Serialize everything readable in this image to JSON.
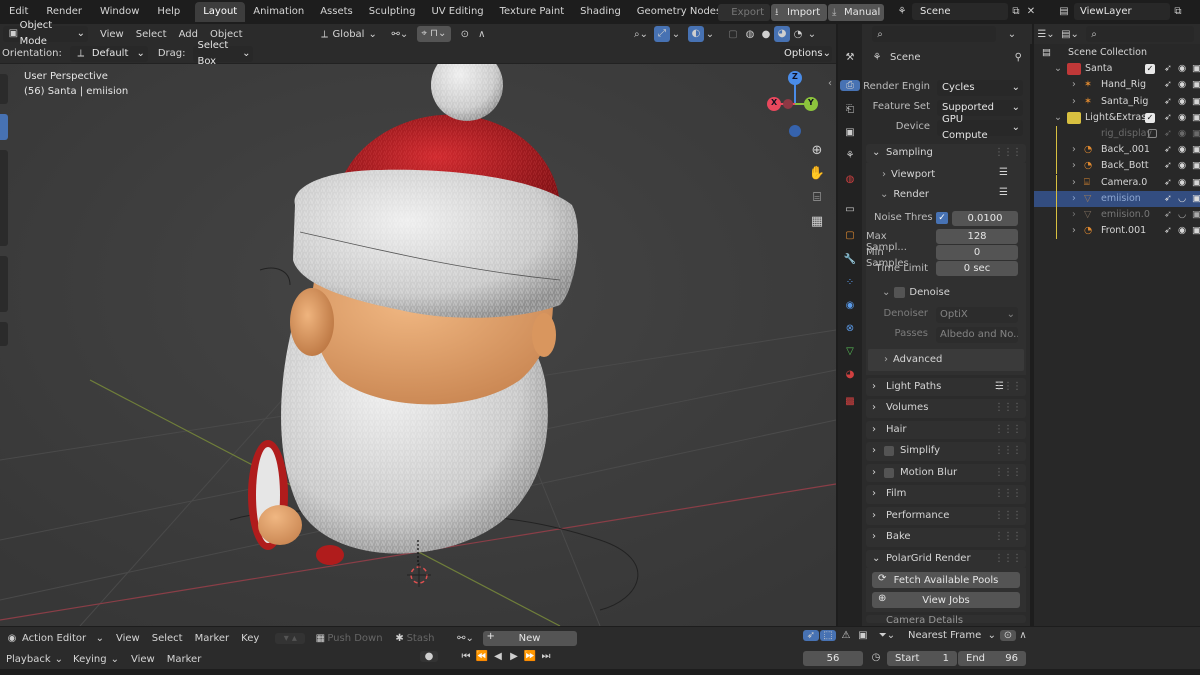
{
  "topbar": {
    "menu": [
      "Edit",
      "Render",
      "Window",
      "Help"
    ],
    "workspaces": [
      "Layout",
      "Animation",
      "Assets",
      "Sculpting",
      "UV Editing",
      "Texture Paint",
      "Shading",
      "Geometry Nodes"
    ],
    "active_workspace": "Layout",
    "add_tab": "+",
    "export_label": "Export",
    "import_label": "Import",
    "manual_label": "Manual",
    "scene_value": "Scene",
    "viewlayer_value": "ViewLayer"
  },
  "viewport_header": {
    "mode": "Object Mode",
    "menus": [
      "View",
      "Select",
      "Add",
      "Object"
    ],
    "transform_orientation": "Global",
    "orientation_label": "Orientation:",
    "orientation_value": "Default",
    "drag_label": "Drag:",
    "drag_value": "Select Box",
    "options_label": "Options"
  },
  "viewport": {
    "perspective": "User Perspective",
    "object_info": "(56) Santa | emiision",
    "gizmo": {
      "x": "X",
      "y": "Y",
      "z": "Z"
    }
  },
  "properties": {
    "header_title": "Scene",
    "render_engine_label": "Render Engin",
    "render_engine_value": "Cycles",
    "feature_set_label": "Feature Set",
    "feature_set_value": "Supported",
    "device_label": "Device",
    "device_value": "GPU Compute",
    "sampling_label": "Sampling",
    "viewport_label": "Viewport",
    "render_label": "Render",
    "noise_thresh_label": "Noise Thres",
    "noise_thresh_value": "0.0100",
    "max_samples_label": "Max Sampl...",
    "max_samples_value": "128",
    "min_samples_label": "Min Samples",
    "min_samples_value": "0",
    "time_limit_label": "Time Limit",
    "time_limit_value": "0 sec",
    "denoise_label": "Denoise",
    "denoiser_label": "Denoiser",
    "denoiser_value": "OptiX",
    "passes_label": "Passes",
    "passes_value": "Albedo and No...",
    "advanced_label": "Advanced",
    "panels": [
      "Light Paths",
      "Volumes",
      "Hair",
      "Simplify",
      "Motion Blur",
      "Film",
      "Performance",
      "Bake"
    ],
    "polargrid_label": "PolarGrid Render",
    "fetch_pools_label": "Fetch Available Pools",
    "view_jobs_label": "View Jobs",
    "cut_label": "Camera Details"
  },
  "outliner": {
    "root": "Scene Collection",
    "items": [
      {
        "name": "Santa",
        "level": 0
      },
      {
        "name": "Hand_Rig",
        "level": 1
      },
      {
        "name": "Santa_Rig",
        "level": 1
      },
      {
        "name": "Light&Extras",
        "level": 0
      },
      {
        "name": "rig_display",
        "level": 1
      },
      {
        "name": "Back_.001",
        "level": 1
      },
      {
        "name": "Back_Bott",
        "level": 1
      },
      {
        "name": "Camera.0",
        "level": 1
      },
      {
        "name": "emiision",
        "level": 1
      },
      {
        "name": "emiision.0",
        "level": 1
      },
      {
        "name": "Front.001",
        "level": 1
      }
    ]
  },
  "timeline": {
    "editor": "Action Editor",
    "menus": [
      "View",
      "Select",
      "Marker",
      "Key"
    ],
    "push_down": "Push Down",
    "stash": "Stash",
    "new_label": "New",
    "snap": "Nearest Frame",
    "playback": "Playback",
    "keying": "Keying",
    "view": "View",
    "marker": "Marker",
    "current_frame": "56",
    "start_label": "Start",
    "start_value": "1",
    "end_label": "End",
    "end_value": "96"
  },
  "colors": {
    "accent": "#4772b3",
    "hat_red": "#b61e24",
    "fur_white": "#d8d8d8",
    "skin": "#e0a36e",
    "x_axis": "#e8485d",
    "y_axis": "#8cc43c",
    "z_axis": "#4a8ce8"
  }
}
